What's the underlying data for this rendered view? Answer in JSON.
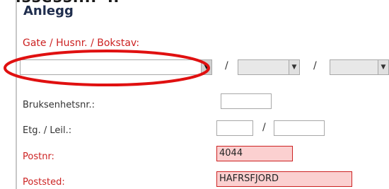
{
  "header": {
    "cut_text": "ıssessıııı•ıı",
    "section_title": "Anlegg"
  },
  "form": {
    "street_label": "Gate / Husnr. / Bokstav:",
    "street_value": "",
    "separator": "/",
    "bruksenhet_label": "Bruksenhetsnr.:",
    "bruksenhet_value": "",
    "etg_label": "Etg. / Leil.:",
    "etg_value": "",
    "leil_value": "",
    "postnr_label": "Postnr:",
    "postnr_value": "4044",
    "poststed_label": "Poststed:",
    "poststed_value": "HAFRSFJORD"
  },
  "colors": {
    "required_label": "#cc2222",
    "error_field_bg": "#fbd0d0",
    "annotation_ellipse": "#e01010"
  },
  "icons": {
    "dropdown": "chevron-down-icon"
  }
}
